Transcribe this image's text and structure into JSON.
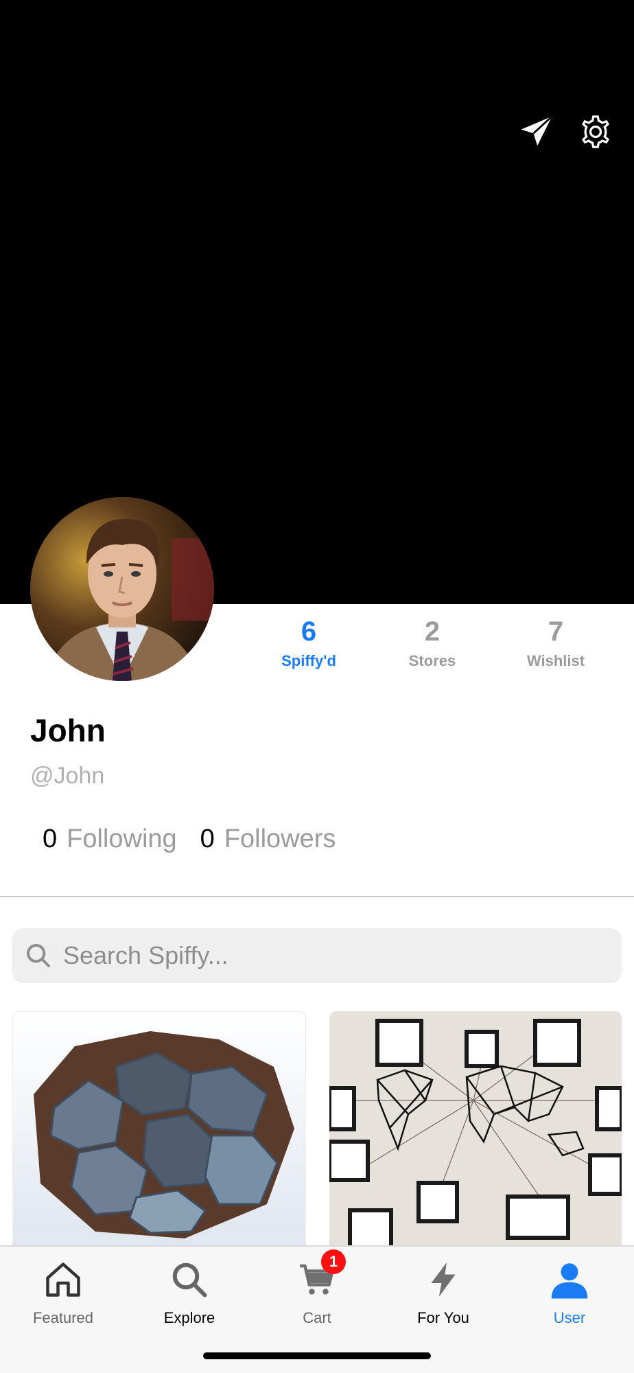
{
  "profile": {
    "name": "John",
    "handle": "@John",
    "stats": [
      {
        "value": "6",
        "label": "Spiffy'd",
        "active": true
      },
      {
        "value": "2",
        "label": "Stores",
        "active": false
      },
      {
        "value": "7",
        "label": "Wishlist",
        "active": false
      }
    ],
    "following": {
      "count": "0",
      "label": "Following"
    },
    "followers": {
      "count": "0",
      "label": "Followers"
    }
  },
  "header": {
    "icons": [
      "paper-plane-icon",
      "gear-icon"
    ]
  },
  "search": {
    "placeholder": "Search Spiffy..."
  },
  "products": [
    {
      "name": "hexagon-cushion-chair-image"
    },
    {
      "name": "world-map-photo-wall-image"
    }
  ],
  "tabbar": {
    "tabs": [
      {
        "label": "Featured",
        "icon": "home-icon"
      },
      {
        "label": "Explore",
        "icon": "search-icon"
      },
      {
        "label": "Cart",
        "icon": "cart-icon",
        "badge": "1"
      },
      {
        "label": "For You",
        "icon": "lightning-icon"
      },
      {
        "label": "User",
        "icon": "user-icon"
      }
    ]
  },
  "colors": {
    "accent": "#1a7cf5",
    "muted": "#9b9b9b",
    "badge": "#ff1010",
    "cover": "#000000"
  }
}
